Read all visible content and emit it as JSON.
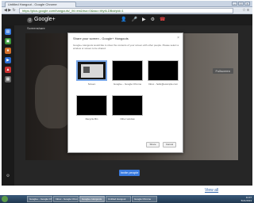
{
  "browser": {
    "tab_title": "Untitled Hangout - Google Chrome",
    "url": "https://plus.google.com/hangouts/_/hl=en&hso=0&ssc=WyIiLDBd#pid=1",
    "window_buttons": [
      "–",
      "□",
      "×"
    ]
  },
  "app": {
    "brand": "Google+",
    "subtitle": "Screenshare",
    "fullscreen_label": "Fullscreen",
    "invite_label": "Invite people"
  },
  "dialog": {
    "title": "Share your screen - Google+ Hangouts",
    "description": "Google+ Hangouts would like to show the contents of your screen with other people. Please select a window or screen to be shared.",
    "tiles": [
      {
        "caption": "Screen",
        "selected": true
      },
      {
        "caption": "Google+ - Google Chrome",
        "selected": false
      },
      {
        "caption": "Inbox - hello@example.com",
        "selected": false
      },
      {
        "caption": "Recycle Bin",
        "selected": false
      },
      {
        "caption": "Other window",
        "selected": false
      }
    ],
    "share_label": "Share",
    "cancel_label": "Cancel"
  },
  "page": {
    "view_all": "View all"
  },
  "taskbar": {
    "items": [
      "Google+ - Google Chrome",
      "Inbox - Google Chrome",
      "Google+ Hangouts",
      "Untitled Hangout",
      "Google Chrome"
    ],
    "time": "11:07",
    "date": "5/21/2013"
  },
  "colors": {
    "accent": "#3b7ce0",
    "hangup": "#e44444",
    "app_bg": "#262626"
  }
}
